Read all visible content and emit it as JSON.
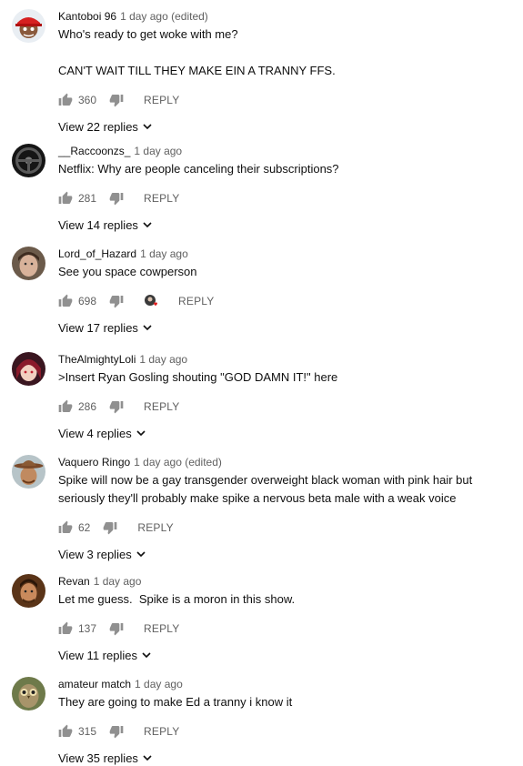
{
  "comments": [
    {
      "author": "Kantoboi 96",
      "meta": "1 day ago (edited)",
      "paragraphs": [
        "Who's ready to get woke with me?",
        "CAN'T WAIT TILL THEY MAKE EIN A TRANNY FFS."
      ],
      "likes": "360",
      "reply_label": "REPLY",
      "replies_label": "View 22 replies",
      "avatar_icon": "avatar-red-cap-icon",
      "heart": false
    },
    {
      "author": "__Raccoonzs_",
      "meta": "1 day ago",
      "paragraphs": [
        "Netflix: Why are people canceling their subscriptions?"
      ],
      "likes": "281",
      "reply_label": "REPLY",
      "replies_label": "View 14 replies",
      "avatar_icon": "avatar-steering-wheel-icon",
      "heart": false
    },
    {
      "author": "Lord_of_Hazard",
      "meta": "1 day ago",
      "paragraphs": [
        "See you space cowperson"
      ],
      "likes": "698",
      "reply_label": "REPLY",
      "replies_label": "View 17 replies",
      "avatar_icon": "avatar-face-icon",
      "heart": true
    },
    {
      "author": "TheAlmightyLoli",
      "meta": "1 day ago",
      "paragraphs": [
        ">Insert Ryan Gosling shouting \"GOD DAMN IT!\" here"
      ],
      "likes": "286",
      "reply_label": "REPLY",
      "replies_label": "View 4 replies",
      "avatar_icon": "avatar-anime-icon",
      "heart": false
    },
    {
      "author": "Vaquero Ringo",
      "meta": "1 day ago (edited)",
      "paragraphs": [
        "Spike will now be a gay transgender overweight black woman with pink hair but seriously they'll probably make spike a nervous beta male with a weak voice"
      ],
      "likes": "62",
      "reply_label": "REPLY",
      "replies_label": "View 3 replies",
      "avatar_icon": "avatar-cowboy-icon",
      "heart": false
    },
    {
      "author": "Revan",
      "meta": "1 day ago",
      "paragraphs": [
        "Let me guess.  Spike is a moron in this show."
      ],
      "likes": "137",
      "reply_label": "REPLY",
      "replies_label": "View 11 replies",
      "avatar_icon": "avatar-man-icon",
      "heart": false
    },
    {
      "author": "amateur match",
      "meta": "1 day ago",
      "paragraphs": [
        "They are going to make Ed a tranny i know it"
      ],
      "likes": "315",
      "reply_label": "REPLY",
      "replies_label": "View 35 replies",
      "avatar_icon": "avatar-owl-icon",
      "heart": false
    }
  ]
}
